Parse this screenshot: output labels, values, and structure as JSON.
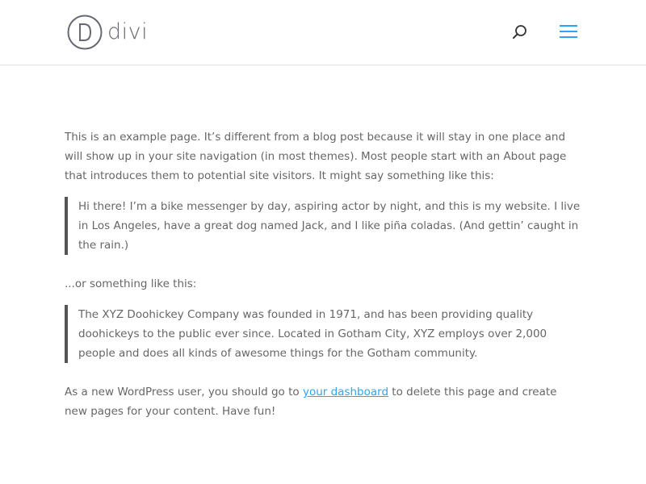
{
  "header": {
    "logo_text": "divi",
    "logo_mark_icon": "divi-d-logo-icon",
    "search_icon": "search-icon",
    "menu_icon": "hamburger-menu-icon"
  },
  "content": {
    "paragraph_1": "This is an example page. It’s different from a blog post because it will stay in one place and will show up in your site navigation (in most themes). Most people start with an About page that introduces them to potential site visitors. It might say something like this:",
    "quote_1": "Hi there! I’m a bike messenger by day, aspiring actor by night, and this is my website. I live in Los Angeles, have a great dog named Jack, and I like piña coladas. (And gettin’ caught in the rain.)",
    "paragraph_2": "...or something like this:",
    "quote_2": "The XYZ Doohickey Company was founded in 1971, and has been providing quality doohickeys to the public ever since. Located in Gotham City, XYZ employs over 2,000 people and does all kinds of awesome things for the Gotham community.",
    "paragraph_3_before": "As a new WordPress user, you should go to ",
    "paragraph_3_link": "your dashboard",
    "paragraph_3_after": " to delete this page and create new pages for your content. Have fun!"
  },
  "colors": {
    "text": "#666666",
    "link": "#2ea3f2",
    "quote_border": "#555555",
    "header_border": "#e8e8e8"
  }
}
